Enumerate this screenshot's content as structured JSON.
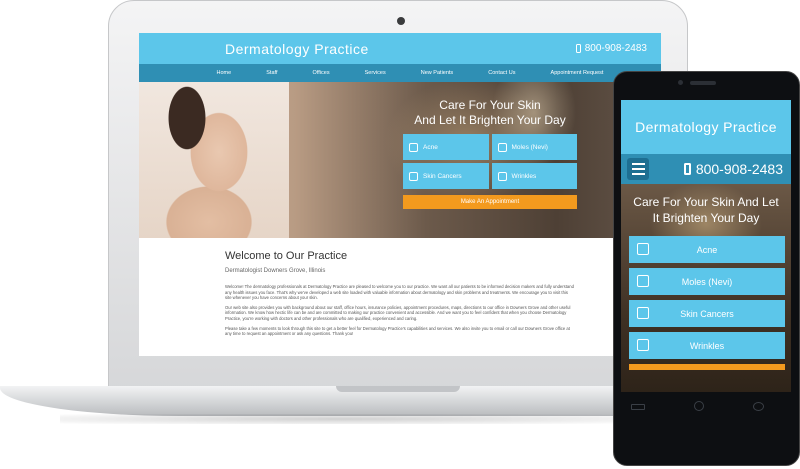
{
  "site": {
    "brand": "Dermatology Practice",
    "phone": "800-908-2483",
    "accent_color": "#5cc6ea",
    "nav_color": "#2f8fb4",
    "cta_color": "#f39a1e"
  },
  "nav": {
    "items": [
      "Home",
      "Staff",
      "Offices",
      "Services",
      "New Patients",
      "Contact Us",
      "Appointment Request"
    ]
  },
  "hero": {
    "title_line1": "Care For Your Skin",
    "title_line2": "And Let It Brighten Your Day",
    "tiles": [
      {
        "label": "Acne",
        "icon": "face-icon"
      },
      {
        "label": "Moles (Nevi)",
        "icon": "magnifier-icon"
      },
      {
        "label": "Skin Cancers",
        "icon": "bandage-icon"
      },
      {
        "label": "Wrinkles",
        "icon": "hand-icon"
      }
    ],
    "cta": "Make An Appointment"
  },
  "content": {
    "heading": "Welcome to Our Practice",
    "subheading": "Dermatologist Downers Grove, Illinois",
    "paragraphs": [
      "Welcome! The dermatology professionals at Dermatology Practice are pleased to welcome you to our practice. We want all our patients to be informed decision makers and fully understand any health issues you face. That's why we've developed a web site loaded with valuable information about dermatology and skin problems and treatments. We encourage you to visit this site whenever you have concerns about your skin.",
      "Our web site also provides you with background about our staff, office hours, insurance policies, appointment procedures, maps, directions to our office in Downers Grove and other useful information. We know how hectic life can be and are committed to making our practice convenient and accessible. And we want you to feel confident that when you choose Dermatology Practice, you're working with doctors and other professionals who are qualified, experienced and caring.",
      "Please take a few moments to look through this site to get a better feel for Dermatology Practice's capabilities and services. We also invite you to email or call our Downers Grove office at any time to request an appointment or ask any questions. Thank you!"
    ]
  },
  "mobile": {
    "title": "Care For Your Skin And Let It Brighten Your Day",
    "tiles": [
      "Acne",
      "Moles (Nevi)",
      "Skin Cancers",
      "Wrinkles"
    ]
  }
}
